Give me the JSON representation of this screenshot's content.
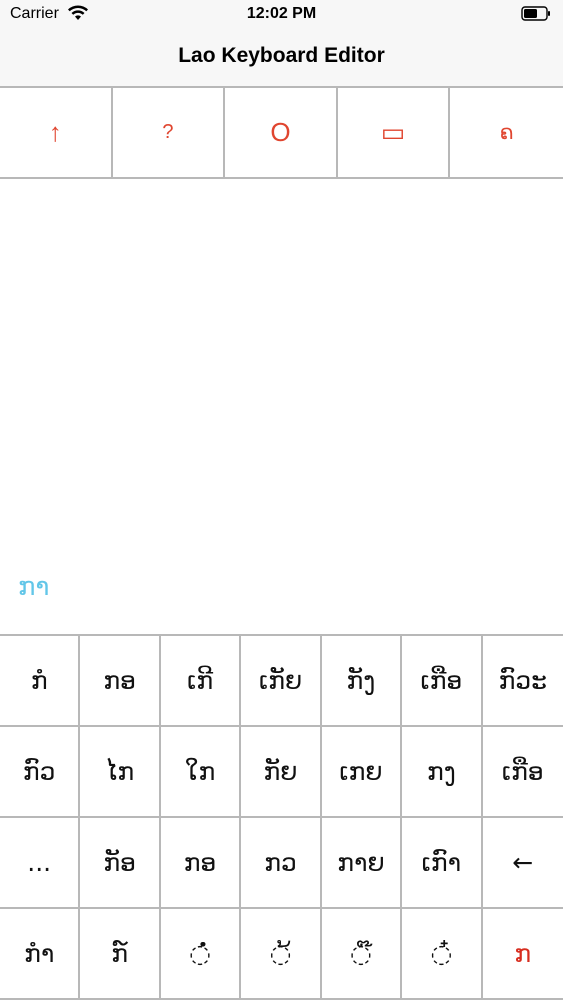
{
  "status_bar": {
    "carrier": "Carrier",
    "time": "12:02 PM",
    "wifi_icon": "wifi-icon",
    "battery_icon": "battery-icon"
  },
  "nav": {
    "title": "Lao Keyboard Editor"
  },
  "toolbar": {
    "buttons": [
      {
        "label": "↑",
        "icon": "up-arrow-icon"
      },
      {
        "label": "?",
        "icon": "question-icon"
      },
      {
        "label": "O",
        "icon": "circle-icon"
      },
      {
        "label": "▭",
        "icon": "rectangle-icon"
      },
      {
        "label": "ຄ",
        "icon": "lao-letter-icon"
      }
    ],
    "accent_color": "#e0452f"
  },
  "editor": {
    "text": "ກາ",
    "text_color": "#62c6e8"
  },
  "keyboard": {
    "rows": [
      [
        "ກໍ",
        "ກອ",
        "ເກີ",
        "ເກັຍ",
        "ກັງ",
        "ເກືອ",
        "ກົວະ"
      ],
      [
        "ກົວ",
        "ໄກ",
        "ໃກ",
        "ກັຍ",
        "ເກຍ",
        "ກງ",
        "ເກືອ"
      ],
      [
        "...",
        "ກັອ",
        "ກອ",
        "ກວ",
        "ກາຍ",
        "ເກົາ",
        "←"
      ],
      [
        "ກໍາ",
        "ກ໌",
        "◌ໍ່",
        "◌້",
        "◌໊",
        "◌໋",
        "ກ"
      ]
    ],
    "highlight_color": "#d72d1f"
  }
}
